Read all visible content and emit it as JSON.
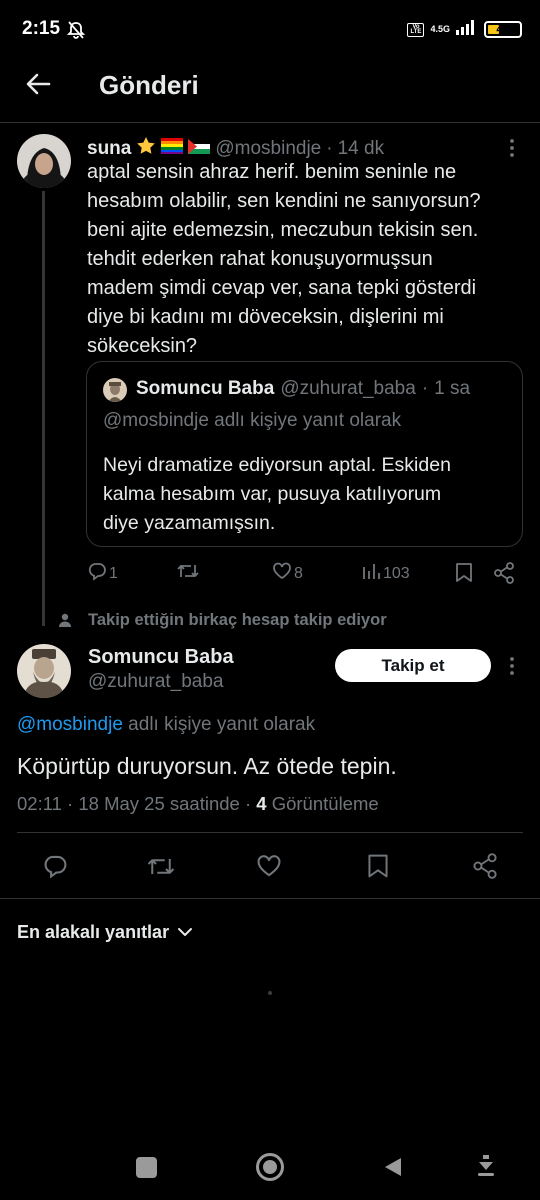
{
  "status_bar": {
    "time": "2:15",
    "network_label": "4.5G",
    "battery": "44",
    "battery_level_percent": 44,
    "volte_label": "Vo LTE"
  },
  "header": {
    "title": "Gönderi"
  },
  "parent_tweet": {
    "display_name": "suna",
    "handle": "@mosbindje",
    "dot": "·",
    "time": "14 dk",
    "text_lines": [
      "aptal sensin ahraz herif. benim seninle ne",
      "hesabım olabilir, sen kendini ne sanıyorsun?",
      "beni ajite edemezsin, meczubun tekisin sen.",
      "tehdit ederken rahat konuşuyormuşsun",
      "madem şimdi cevap ver, sana tepki gösterdi",
      "diye bi kadını mı döveceksin, dişlerini mi",
      "sökeceksin?"
    ],
    "quote": {
      "display_name": "Somuncu Baba",
      "handle": "@zuhurat_baba",
      "dot": "·",
      "time": "1 sa",
      "reply_context": "@mosbindje adlı kişiye yanıt olarak",
      "text_lines": [
        "Neyi dramatize ediyorsun aptal. Eskiden",
        "kalma hesabım var, pusuya katılıyorum",
        "diye yazamamışsın."
      ]
    },
    "actions": {
      "replies": "1",
      "likes": "8",
      "views": "103"
    }
  },
  "social_context": "Takip ettiğin birkaç hesap takip ediyor",
  "main_tweet": {
    "display_name": "Somuncu Baba",
    "handle": "@zuhurat_baba",
    "follow_label": "Takip et",
    "reply_to_handle": "@mosbindje",
    "reply_to_suffix": " adlı kişiye yanıt olarak",
    "text": "Köpürtüp duruyorsun. Az ötede tepin.",
    "timestamp": "02:11 · 18 May 25 saatinde ·",
    "view_count": "4",
    "view_label": "Görüntüleme"
  },
  "replies_sort": {
    "label": "En alakalı yanıtlar"
  },
  "colors": {
    "background": "#000000",
    "text": "#e7e9ea",
    "muted": "#71767b",
    "link": "#1d9bf0",
    "divider": "#2f3336"
  }
}
